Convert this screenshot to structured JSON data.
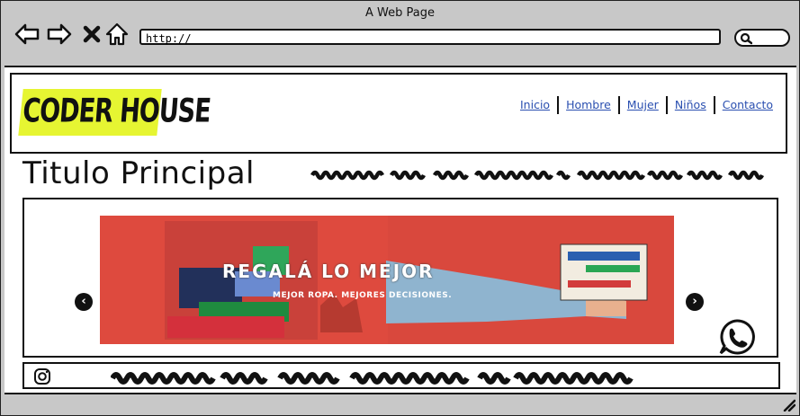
{
  "window": {
    "title": "A Web Page",
    "url": "http://"
  },
  "site": {
    "logo_text": "CODER HOUSE",
    "nav": [
      {
        "label": "Inicio"
      },
      {
        "label": "Hombre"
      },
      {
        "label": "Mujer"
      },
      {
        "label": "Niños"
      },
      {
        "label": "Contacto"
      }
    ],
    "page_title": "Titulo Principal"
  },
  "banner": {
    "headline": "REGALÁ LO MEJOR",
    "subline": "MEJOR ROPA. MEJORES DECISIONES.",
    "background_color": "#de4a3e"
  },
  "colors": {
    "logo_bg": "#e6f532",
    "link": "#2a4fb0",
    "browser_chrome": "#c8c8c8"
  },
  "icons": {
    "back": "left-arrow-icon",
    "forward": "right-arrow-icon",
    "stop": "close-icon",
    "home": "home-icon",
    "search": "search-icon",
    "prev": "chevron-left-icon",
    "next": "chevron-right-icon",
    "whatsapp": "whatsapp-icon",
    "instagram": "instagram-icon"
  }
}
